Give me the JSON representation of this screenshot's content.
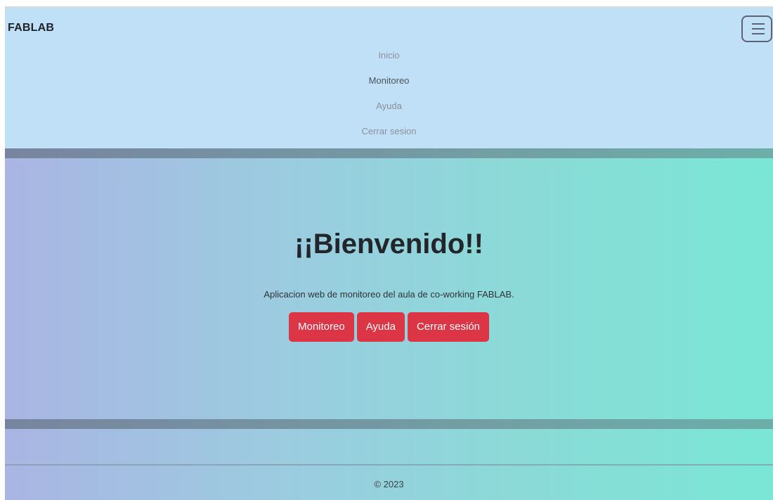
{
  "navbar": {
    "brand": "FABLAB",
    "toggler_icon": "hamburger-menu-icon",
    "links": [
      {
        "label": "Inicio"
      },
      {
        "label": "Monitoreo"
      },
      {
        "label": "Ayuda"
      },
      {
        "label": "Cerrar sesion"
      }
    ]
  },
  "hero": {
    "title": "¡¡Bienvenido!!",
    "subtitle": "Aplicacion web de monitoreo del aula de co-working FABLAB.",
    "buttons": [
      {
        "label": "Monitoreo"
      },
      {
        "label": "Ayuda"
      },
      {
        "label": "Cerrar sesión"
      }
    ]
  },
  "footer": {
    "copyright": "© 2023"
  },
  "colors": {
    "navbar_bg": "#c0e0f7",
    "button_bg": "#dc3545",
    "gradient_start": "#a9b5e3",
    "gradient_end": "#7ae7d6"
  }
}
